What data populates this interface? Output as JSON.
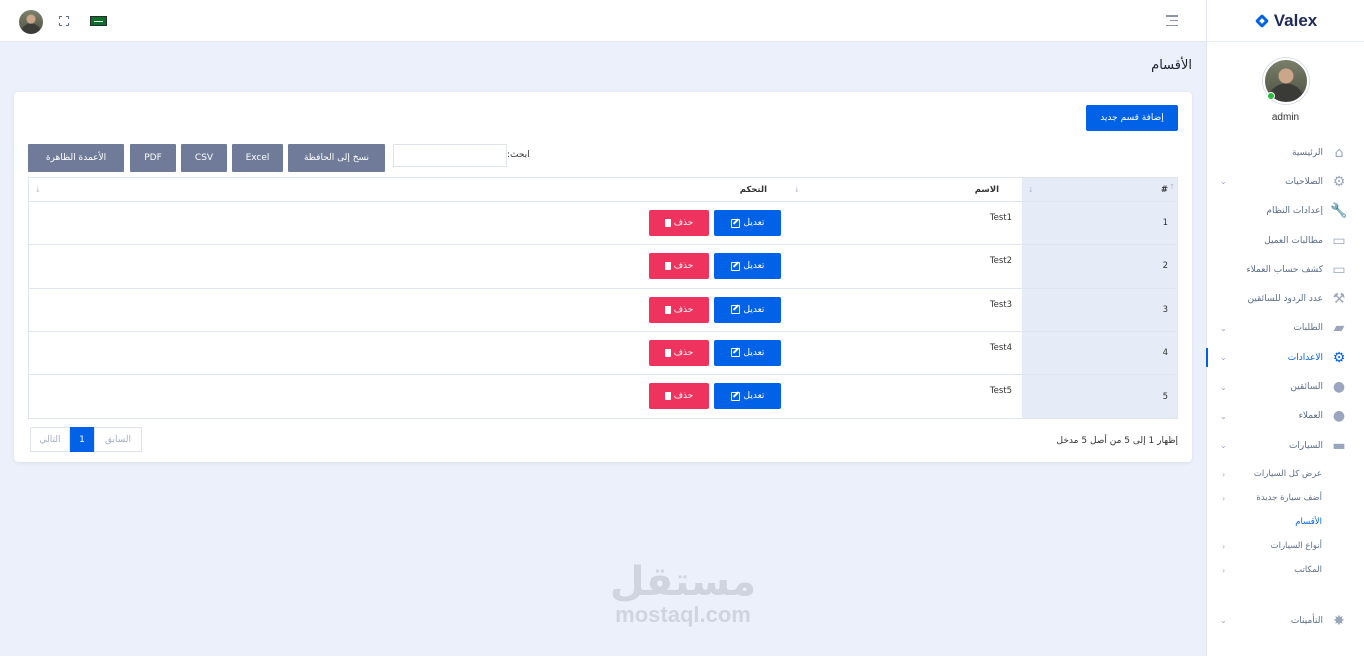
{
  "brand": {
    "name": "Valex",
    "accent": "#0162e8",
    "danger": "#ee335e",
    "export_btn_color": "#6f7b99"
  },
  "profile": {
    "name": "admin",
    "status": "online"
  },
  "topbar": {
    "icons": [
      "menu-toggle-icon",
      "fullscreen-icon",
      "flag-icon",
      "avatar"
    ]
  },
  "page": {
    "title": "الأقسام"
  },
  "sidebar": {
    "items": [
      {
        "label": "الرئيسية",
        "icon": "home-icon",
        "chevron": false
      },
      {
        "label": "الصلاحيات",
        "icon": "user-settings-icon",
        "chevron": true
      },
      {
        "label": "إعدادات النظام",
        "icon": "wrench-icon",
        "chevron": false
      },
      {
        "label": "مطالبات العميل",
        "icon": "money-icon",
        "chevron": false
      },
      {
        "label": "كشف حساب العملاء",
        "icon": "money-icon",
        "chevron": false
      },
      {
        "label": "عدد الردود للسائقين",
        "icon": "tools-icon",
        "chevron": false
      },
      {
        "label": "الطلبات",
        "icon": "truck-icon",
        "chevron": true
      },
      {
        "label": "الاعدادات",
        "icon": "cogs-icon",
        "chevron": true,
        "active": true
      },
      {
        "label": "السائقين",
        "icon": "driver-icon",
        "chevron": true
      },
      {
        "label": "العملاء",
        "icon": "users-icon",
        "chevron": true
      },
      {
        "label": "السيارات",
        "icon": "car-icon",
        "chevron": true,
        "open": true
      }
    ],
    "submenu": [
      {
        "label": "عرض كل السيارات"
      },
      {
        "label": "أضف سيارة جديدة"
      },
      {
        "label": "الأقسام",
        "active": true
      },
      {
        "label": "أنواع السيارات"
      },
      {
        "label": "المكاتب"
      }
    ],
    "after": [
      {
        "label": "التأمينات",
        "icon": "car-crash-icon",
        "chevron": true
      }
    ]
  },
  "toolbar": {
    "add_label": "إضافة قسم جديد",
    "search_label": "ابحث:",
    "search_value": "",
    "export_buttons": [
      "الأعمدة الظاهرة",
      "PDF",
      "CSV",
      "Excel",
      "نسخ إلى الحافظة"
    ]
  },
  "table": {
    "columns": [
      "#",
      "الاسم",
      "التحكم"
    ],
    "rows": [
      {
        "num": "1",
        "name": "Test1"
      },
      {
        "num": "2",
        "name": "Test2"
      },
      {
        "num": "3",
        "name": "Test3"
      },
      {
        "num": "4",
        "name": "Test4"
      },
      {
        "num": "5",
        "name": "Test5"
      }
    ],
    "edit_label": "تعديل",
    "delete_label": "حذف"
  },
  "pagination": {
    "info": "إظهار 1 إلى 5 من أصل 5 مدخل",
    "next": "التالي",
    "current": "1",
    "prev": "السابق"
  },
  "watermark": {
    "arabic": "مستقل",
    "latin": "mostaql.com"
  }
}
